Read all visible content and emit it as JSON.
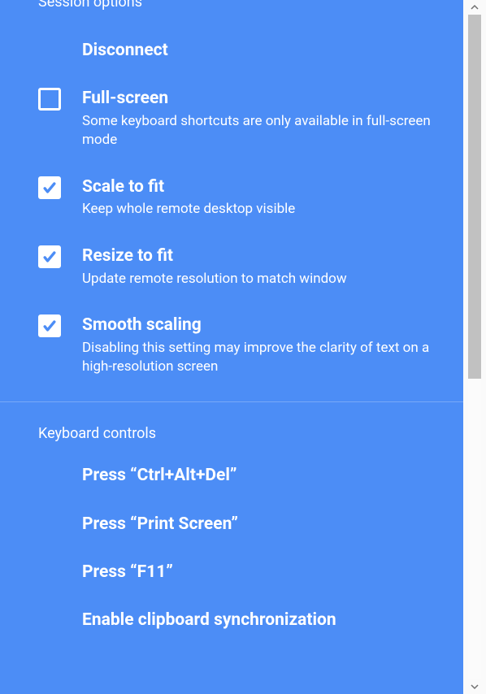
{
  "colors": {
    "panel_bg": "#4c8df6",
    "text": "#ffffff",
    "scroll_thumb": "#c1c1c1"
  },
  "session_options": {
    "heading": "Session options",
    "disconnect": {
      "title": "Disconnect"
    },
    "full_screen": {
      "title": "Full-screen",
      "desc": "Some keyboard shortcuts are only available in full-screen mode",
      "checked": false
    },
    "scale_to_fit": {
      "title": "Scale to fit",
      "desc": "Keep whole remote desktop visible",
      "checked": true
    },
    "resize_to_fit": {
      "title": "Resize to fit",
      "desc": "Update remote resolution to match window",
      "checked": true
    },
    "smooth_scaling": {
      "title": "Smooth scaling",
      "desc": "Disabling this setting may improve the clarity of text on a high-resolution screen",
      "checked": true
    }
  },
  "keyboard_controls": {
    "heading": "Keyboard controls",
    "ctrl_alt_del": {
      "title": "Press “Ctrl+Alt+Del”"
    },
    "print_screen": {
      "title": "Press “Print Screen”"
    },
    "f11": {
      "title": "Press “F11”"
    },
    "clipboard": {
      "title": "Enable clipboard synchronization"
    }
  }
}
